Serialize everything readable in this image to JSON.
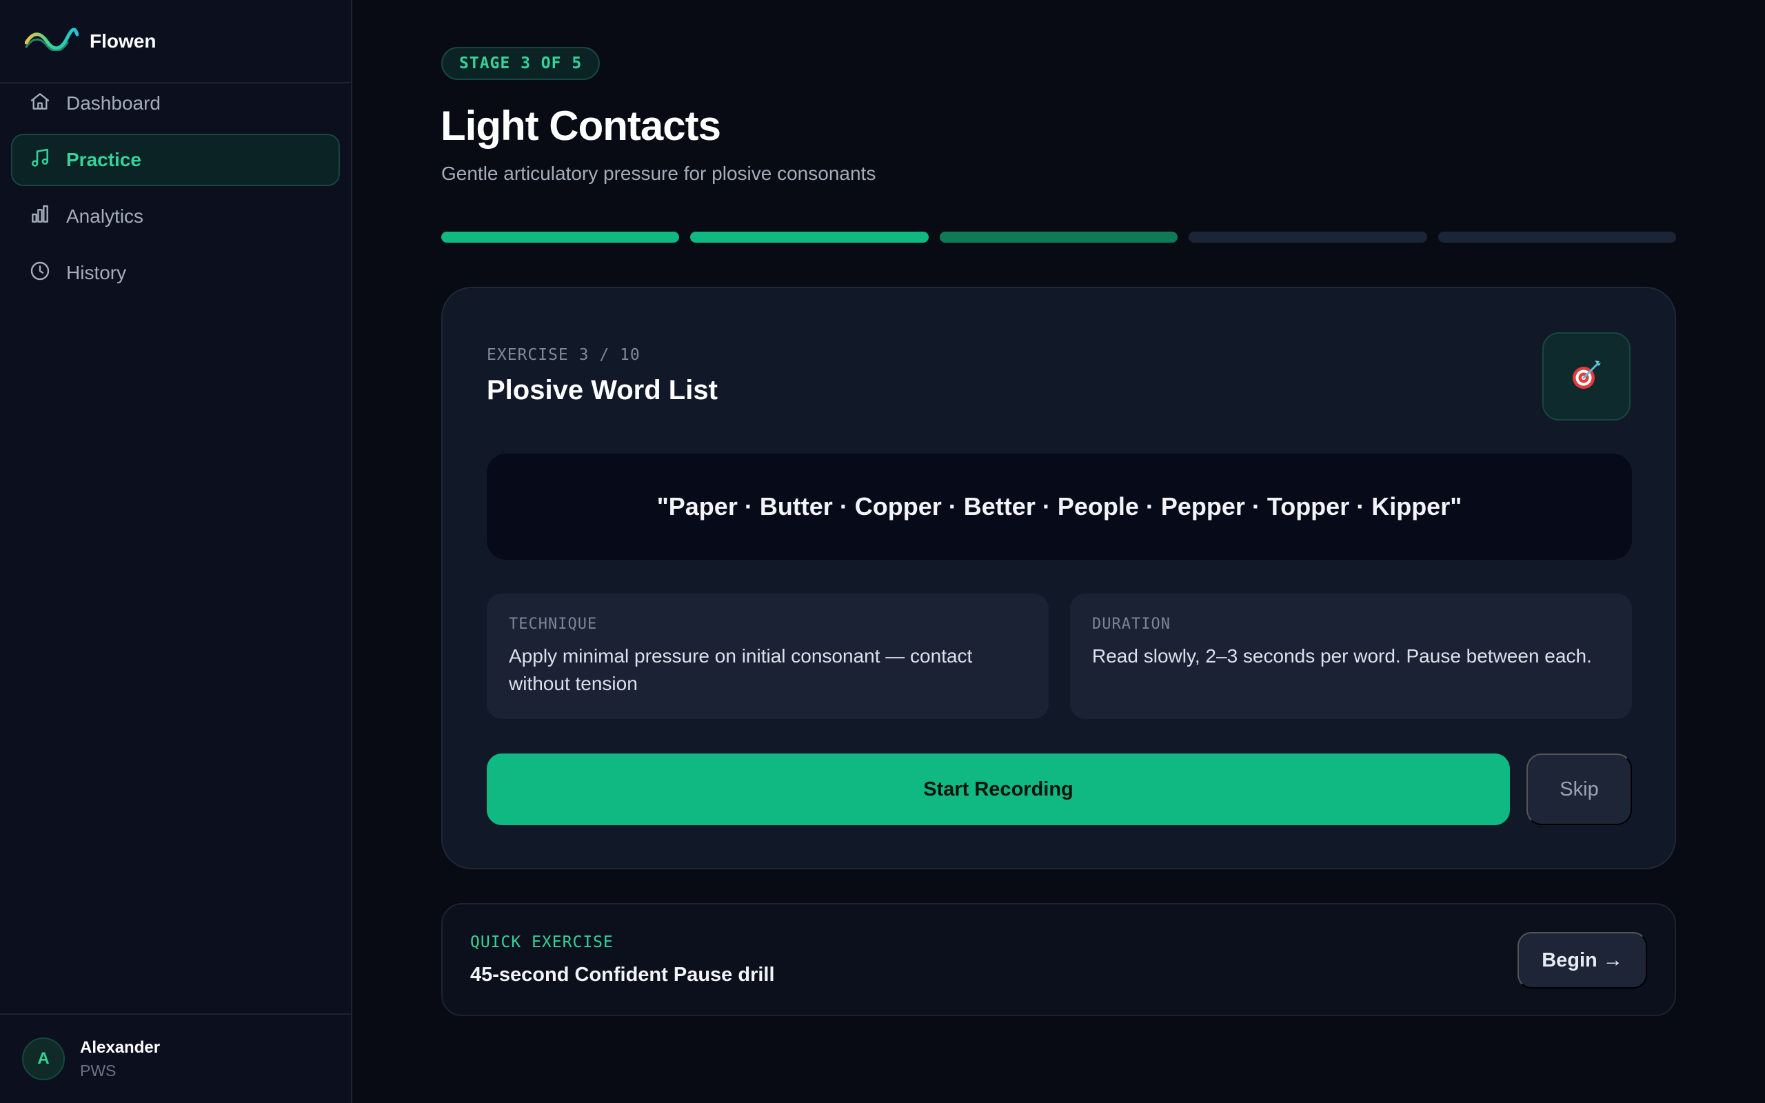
{
  "brand": {
    "name": "Flowen",
    "icon": "wave-logo-icon"
  },
  "sidebar": {
    "items": [
      {
        "label": "Dashboard",
        "icon": "home-icon",
        "active": false
      },
      {
        "label": "Practice",
        "icon": "music-note-icon",
        "active": true
      },
      {
        "label": "Analytics",
        "icon": "bar-chart-icon",
        "active": false
      },
      {
        "label": "History",
        "icon": "clock-icon",
        "active": false
      }
    ]
  },
  "user": {
    "initial": "A",
    "name": "Alexander",
    "subtitle": "PWS"
  },
  "stage": {
    "badge": "STAGE 3 OF 5",
    "title": "Light Contacts",
    "subtitle": "Gentle articulatory pressure for plosive consonants",
    "progress": {
      "total": 5,
      "completed": 2,
      "current": 3
    }
  },
  "exercise": {
    "count": "EXERCISE 3 / 10",
    "title": "Plosive Word List",
    "icon": "target-dart-icon",
    "prompt": "\"Paper · Butter · Copper · Better · People · Pepper · Topper · Kipper\"",
    "technique": {
      "label": "TECHNIQUE",
      "text": "Apply minimal pressure on initial consonant — contact without tension"
    },
    "duration": {
      "label": "DURATION",
      "text": "Read slowly, 2–3 seconds per word. Pause between each."
    },
    "record_label": "Start Recording",
    "skip_label": "Skip"
  },
  "quick": {
    "label": "QUICK EXERCISE",
    "title": "45-second Confident Pause drill",
    "begin_label": "Begin →"
  },
  "colors": {
    "accent": "#10b981",
    "accent_text": "#34d399",
    "background": "#080b14",
    "sidebar": "#0b0f1e",
    "card": "#111828"
  }
}
